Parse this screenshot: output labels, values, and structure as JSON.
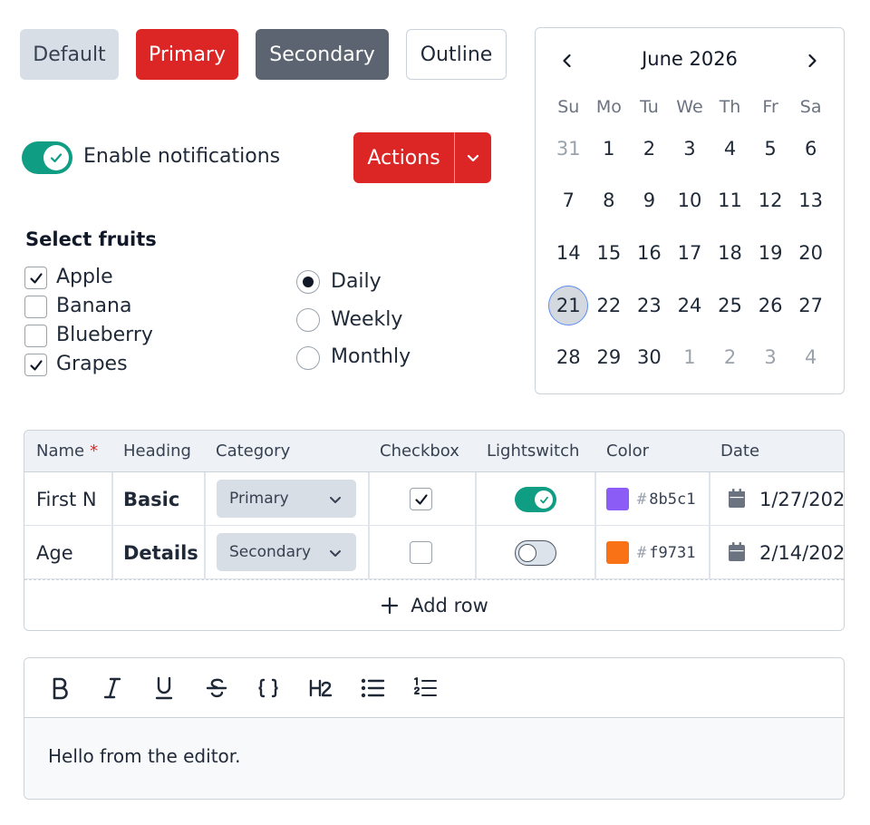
{
  "buttons": {
    "default_label": "Default",
    "primary_label": "Primary",
    "secondary_label": "Secondary",
    "outline_label": "Outline"
  },
  "notifications_toggle": {
    "label": "Enable notifications",
    "on": true
  },
  "actions_button": {
    "label": "Actions"
  },
  "fruits": {
    "title": "Select fruits",
    "items": [
      {
        "label": "Apple",
        "checked": true
      },
      {
        "label": "Banana",
        "checked": false
      },
      {
        "label": "Blueberry",
        "checked": false
      },
      {
        "label": "Grapes",
        "checked": true
      }
    ]
  },
  "frequency": {
    "options": [
      {
        "label": "Daily",
        "selected": true
      },
      {
        "label": "Weekly",
        "selected": false
      },
      {
        "label": "Monthly",
        "selected": false
      }
    ]
  },
  "calendar": {
    "title": "June 2026",
    "weekdays": [
      "Su",
      "Mo",
      "Tu",
      "We",
      "Th",
      "Fr",
      "Sa"
    ],
    "weeks": [
      [
        "31",
        "1",
        "2",
        "3",
        "4",
        "5",
        "6"
      ],
      [
        "7",
        "8",
        "9",
        "10",
        "11",
        "12",
        "13"
      ],
      [
        "14",
        "15",
        "16",
        "17",
        "18",
        "19",
        "20"
      ],
      [
        "21",
        "22",
        "23",
        "24",
        "25",
        "26",
        "27"
      ],
      [
        "28",
        "29",
        "30",
        "1",
        "2",
        "3",
        "4"
      ]
    ],
    "selected_day": "21"
  },
  "table": {
    "headers": {
      "name": "Name",
      "required_mark": "*",
      "heading": "Heading",
      "category": "Category",
      "checkbox": "Checkbox",
      "lightswitch": "Lightswitch",
      "color": "Color",
      "date": "Date"
    },
    "rows": [
      {
        "name": "First N",
        "heading": "Basic",
        "category": "Primary",
        "checked": true,
        "switch_on": true,
        "color_hex": "8b5c1",
        "color": "#8b5cf6",
        "date": "1/27/202"
      },
      {
        "name": "Age",
        "heading": "Details",
        "category": "Secondary",
        "checked": false,
        "switch_on": false,
        "color_hex": "f9731",
        "color": "#f97316",
        "date": "2/14/202"
      }
    ],
    "add_row_label": "Add row",
    "hash": "#"
  },
  "editor": {
    "tools": [
      "bold-icon",
      "italic-icon",
      "underline-icon",
      "strikethrough-icon",
      "code-icon",
      "heading-2-icon",
      "bullet-list-icon",
      "numbered-list-icon"
    ],
    "content": "Hello from the editor."
  },
  "colors": {
    "primary": "#dc2626",
    "secondary": "#5b6470",
    "teal": "#0f9d83",
    "border": "#cbd2da"
  }
}
